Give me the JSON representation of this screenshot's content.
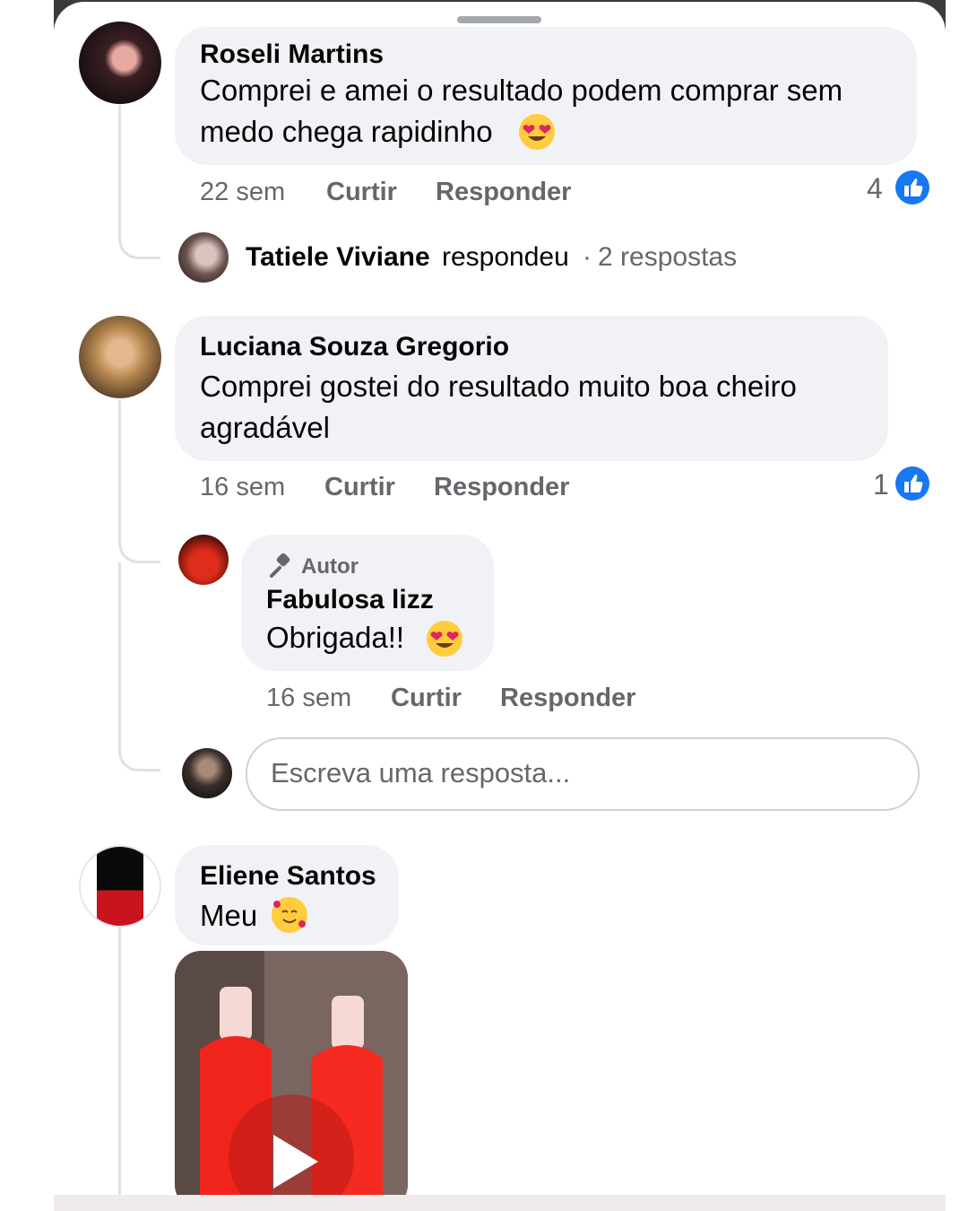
{
  "comments": [
    {
      "author": "Roseli Martins",
      "text_line1": "Comprei e amei o resultado podem comprar sem",
      "text_line2": "medo chega rapidinho",
      "emoji": "heart-eyes-emoji",
      "time": "22 sem",
      "like_label": "Curtir",
      "reply_label": "Responder",
      "reactions": "4",
      "replies_summary": {
        "name": "Tatiele Viviane",
        "verb": "respondeu",
        "separator": "·",
        "count_text": "2 respostas"
      }
    },
    {
      "author": "Luciana Souza Gregorio",
      "text_line1": "Comprei  gostei do resultado  muito boa cheiro",
      "text_line2": "agradável",
      "time": "16 sem",
      "like_label": "Curtir",
      "reply_label": "Responder",
      "reactions": "1",
      "reply": {
        "badge": "Autor",
        "badge_icon": "microphone-icon",
        "author": "Fabulosa lizz",
        "text": "Obrigada!!",
        "emoji": "heart-eyes-emoji",
        "time": "16 sem",
        "like_label": "Curtir",
        "reply_label": "Responder"
      },
      "reply_input_placeholder": "Escreva uma resposta..."
    },
    {
      "author": "Eliene Santos",
      "text": "Meu",
      "emoji": "smiling-face-with-hearts-emoji",
      "attachment": "video-thumbnail",
      "attachment_icon": "play-icon"
    }
  ],
  "colors": {
    "bubble": "#f0f2f5",
    "meta_text": "#65676b",
    "like_blue": "#1877f2",
    "thread_line": "#dfe1e4"
  }
}
